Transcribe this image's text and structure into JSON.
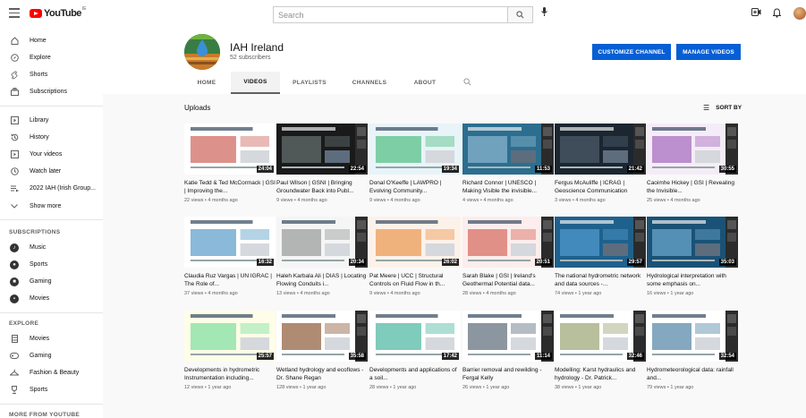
{
  "header": {
    "logo_word": "YouTube",
    "logo_country": "IE",
    "search_placeholder": "Search",
    "icons": [
      "menu-icon",
      "search-icon",
      "mic-icon",
      "create-icon",
      "bell-icon",
      "account-avatar"
    ]
  },
  "sidebar": {
    "main": [
      {
        "label": "Home",
        "icon": "home-icon"
      },
      {
        "label": "Explore",
        "icon": "compass-icon"
      },
      {
        "label": "Shorts",
        "icon": "shorts-icon"
      },
      {
        "label": "Subscriptions",
        "icon": "subscriptions-icon"
      }
    ],
    "library": [
      {
        "label": "Library",
        "icon": "library-icon"
      },
      {
        "label": "History",
        "icon": "history-icon"
      },
      {
        "label": "Your videos",
        "icon": "your-videos-icon"
      },
      {
        "label": "Watch later",
        "icon": "clock-icon"
      },
      {
        "label": "2022 IAH (Irish Group...",
        "icon": "playlist-icon"
      },
      {
        "label": "Show more",
        "icon": "chevron-down-icon"
      }
    ],
    "subscriptions_heading": "SUBSCRIPTIONS",
    "subscriptions": [
      {
        "label": "Music"
      },
      {
        "label": "Sports"
      },
      {
        "label": "Gaming"
      },
      {
        "label": "Movies"
      }
    ],
    "explore_heading": "EXPLORE",
    "explore": [
      {
        "label": "Movies",
        "icon": "film-icon"
      },
      {
        "label": "Gaming",
        "icon": "gamepad-icon"
      },
      {
        "label": "Fashion & Beauty",
        "icon": "hanger-icon"
      },
      {
        "label": "Sports",
        "icon": "trophy-icon"
      }
    ],
    "more_heading": "MORE FROM YOUTUBE"
  },
  "channel": {
    "name": "IAH Ireland",
    "subscribers": "52 subscribers",
    "customize_label": "CUSTOMIZE CHANNEL",
    "manage_label": "MANAGE VIDEOS",
    "tabs": [
      "HOME",
      "VIDEOS",
      "PLAYLISTS",
      "CHANNELS",
      "ABOUT"
    ],
    "active_tab": "VIDEOS"
  },
  "uploads": {
    "heading": "Uploads",
    "sort_label": "SORT BY",
    "videos": [
      {
        "title": "Katie Tedd & Ted McCormack | GSI | Improving the...",
        "meta": "22 views • 4 months ago",
        "duration": "24:04",
        "bg": "#ffffff",
        "accent": "#c0392b",
        "dark": false
      },
      {
        "title": "Paul Wilson | GSNI | Bringing Groundwater Back into Publ...",
        "meta": "9 views • 4 months ago",
        "duration": "22:54",
        "bg": "#1a1a1a",
        "accent": "#7f8c8d",
        "dark": true
      },
      {
        "title": "Donal O'Keeffe | LAWPRO | Evolving Community...",
        "meta": "9 views • 4 months ago",
        "duration": "19:34",
        "bg": "#e8f4f8",
        "accent": "#27ae60",
        "dark": false
      },
      {
        "title": "Richard Connor | UNESCO | Making Visible the invisible...",
        "meta": "4 views • 4 months ago",
        "duration": "11:53",
        "bg": "#2c6e8f",
        "accent": "#a9cce3",
        "dark": true
      },
      {
        "title": "Fergus McAuliffe | ICRAG | Geoscience Communication",
        "meta": "3 views • 4 months ago",
        "duration": "21:42",
        "bg": "#1b2631",
        "accent": "#5d6d7e",
        "dark": true
      },
      {
        "title": "Caoimhe Hickey | GSI | Revealing the Invisible...",
        "meta": "25 views • 4 months ago",
        "duration": "30:55",
        "bg": "#f4ecf7",
        "accent": "#8e44ad",
        "dark": false
      },
      {
        "title": "Claudia Ruz Vargas | UN IGRAC | The Role of...",
        "meta": "37 views • 4 months ago",
        "duration": "16:32",
        "bg": "#ffffff",
        "accent": "#2980b9",
        "dark": false
      },
      {
        "title": "Haleh Karbala Ali | DIAS | Locating Flowing Conduits i...",
        "meta": "13 views • 4 months ago",
        "duration": "20:34",
        "bg": "#f5f5f5",
        "accent": "#7b7d7d",
        "dark": false
      },
      {
        "title": "Pat Meere | UCC | Structural Controls on Fluid Flow in th...",
        "meta": "9 views • 4 months ago",
        "duration": "26:02",
        "bg": "#fdf2e9",
        "accent": "#e67e22",
        "dark": false
      },
      {
        "title": "Sarah Blake | GSI | Ireland's Geothermal Potential data...",
        "meta": "28 views • 4 months ago",
        "duration": "20:51",
        "bg": "#fdedec",
        "accent": "#cb4335",
        "dark": false
      },
      {
        "title": "The national hydrometric network and data sources -...",
        "meta": "74 views • 1 year ago",
        "duration": "29:57",
        "bg": "#1f618d",
        "accent": "#5dade2",
        "dark": true
      },
      {
        "title": "Hydrological interpretation with some emphasis on...",
        "meta": "16 views • 1 year ago",
        "duration": "35:03",
        "bg": "#1a5276",
        "accent": "#85c1e9",
        "dark": true
      },
      {
        "title": "Developments in hydrometric Instrumentation including...",
        "meta": "12 views • 1 year ago",
        "duration": "25:57",
        "bg": "#fefde7",
        "accent": "#58d68d",
        "dark": false
      },
      {
        "title": "Wetland hydrology and ecoflows - Dr. Shane Regan",
        "meta": "128 views • 1 year ago",
        "duration": "35:58",
        "bg": "#ffffff",
        "accent": "#6e2c00",
        "dark": false
      },
      {
        "title": "Developments and applications of a soil...",
        "meta": "28 views • 1 year ago",
        "duration": "17:42",
        "bg": "#ffffff",
        "accent": "#16a085",
        "dark": false
      },
      {
        "title": "Barrier removal and rewilding - Fergal Kelly",
        "meta": "26 views • 1 year ago",
        "duration": "11:14",
        "bg": "#ffffff",
        "accent": "#2e4053",
        "dark": false
      },
      {
        "title": "Modelling: Karst hydraulics and hydrology - Dr. Patrick...",
        "meta": "38 views • 1 year ago",
        "duration": "32:46",
        "bg": "#ffffff",
        "accent": "#7d8a4a",
        "dark": false
      },
      {
        "title": "Hydrometeorological data: rainfall and...",
        "meta": "79 views • 1 year ago",
        "duration": "32:54",
        "bg": "#ffffff",
        "accent": "#1f618d",
        "dark": false
      }
    ]
  }
}
